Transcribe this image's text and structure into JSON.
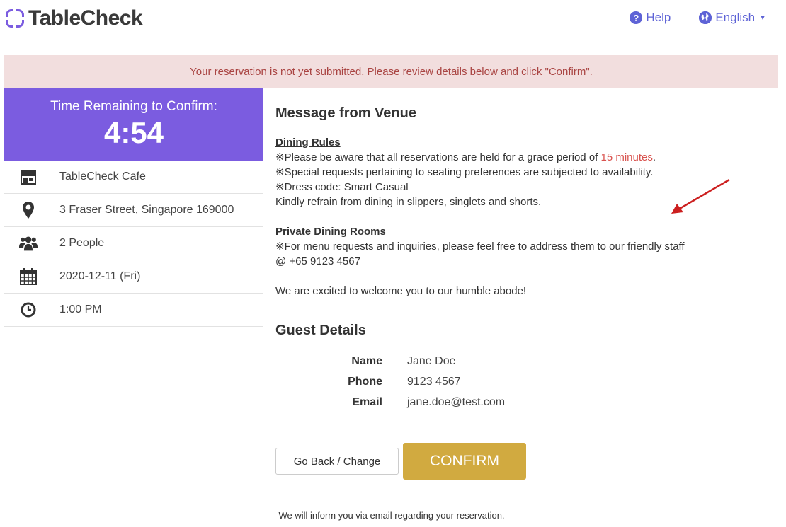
{
  "header": {
    "logo_text": "TableCheck",
    "help_label": "Help",
    "language_label": "English"
  },
  "alert": {
    "message": "Your reservation is not yet submitted. Please review details below and click \"Confirm\"."
  },
  "sidebar": {
    "timer_label": "Time Remaining to Confirm:",
    "timer_value": "4:54",
    "items": [
      {
        "icon": "store-icon",
        "label": "TableCheck Cafe"
      },
      {
        "icon": "map-pin-icon",
        "label": "3 Fraser Street, Singapore 169000"
      },
      {
        "icon": "people-icon",
        "label": "2 People"
      },
      {
        "icon": "calendar-icon",
        "label": "2020-12-11 (Fri)"
      },
      {
        "icon": "clock-icon",
        "label": "1:00 PM"
      }
    ]
  },
  "message": {
    "title": "Message from Venue",
    "dining_rules_heading": "Dining Rules",
    "rule1_prefix": "※Please be aware that all reservations are held for a grace period of ",
    "rule1_highlight": "15 minutes",
    "rule1_suffix": ".",
    "rule2": "※Special requests pertaining to seating preferences are subjected to availability.",
    "rule3": "※Dress code: Smart Casual",
    "rule4": "Kindly refrain from dining in slippers, singlets and shorts.",
    "private_heading": "Private Dining Rooms",
    "private1": "※For menu requests and inquiries, please feel free to address them to our friendly staff",
    "private2": "@ +65 9123 4567",
    "welcome": "We are excited to welcome you to our humble abode!"
  },
  "guest": {
    "title": "Guest Details",
    "name_label": "Name",
    "name_value": "Jane Doe",
    "phone_label": "Phone",
    "phone_value": "9123 4567",
    "email_label": "Email",
    "email_value": "jane.doe@test.com"
  },
  "actions": {
    "back_label": "Go Back / Change",
    "confirm_label": "CONFIRM"
  },
  "footer": {
    "note": "We will inform you via email regarding your reservation."
  },
  "colors": {
    "brand": "#7b5ce0",
    "link": "#5e63d6",
    "alert_bg": "#f2dede",
    "alert_text": "#a94442",
    "confirm": "#d1aa40",
    "highlight": "#d9534f",
    "arrow": "#cc1f1f"
  }
}
